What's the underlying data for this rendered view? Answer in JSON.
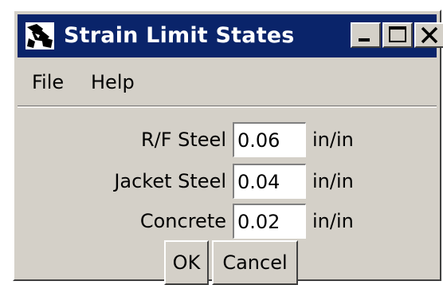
{
  "window": {
    "title": "Strain Limit States",
    "app_icon": "app-logo-icon",
    "titlebar_color": "#0a246a",
    "controls": {
      "minimize_icon": "minimize-icon",
      "maximize_icon": "maximize-icon",
      "close_icon": "close-icon"
    }
  },
  "menu": {
    "file_label": "File",
    "help_label": "Help"
  },
  "fields": [
    {
      "label": "R/F Steel",
      "value": "0.06",
      "unit": "in/in"
    },
    {
      "label": "Jacket Steel",
      "value": "0.04",
      "unit": "in/in"
    },
    {
      "label": "Concrete",
      "value": "0.02",
      "unit": "in/in"
    }
  ],
  "buttons": {
    "ok_label": "OK",
    "cancel_label": "Cancel"
  }
}
